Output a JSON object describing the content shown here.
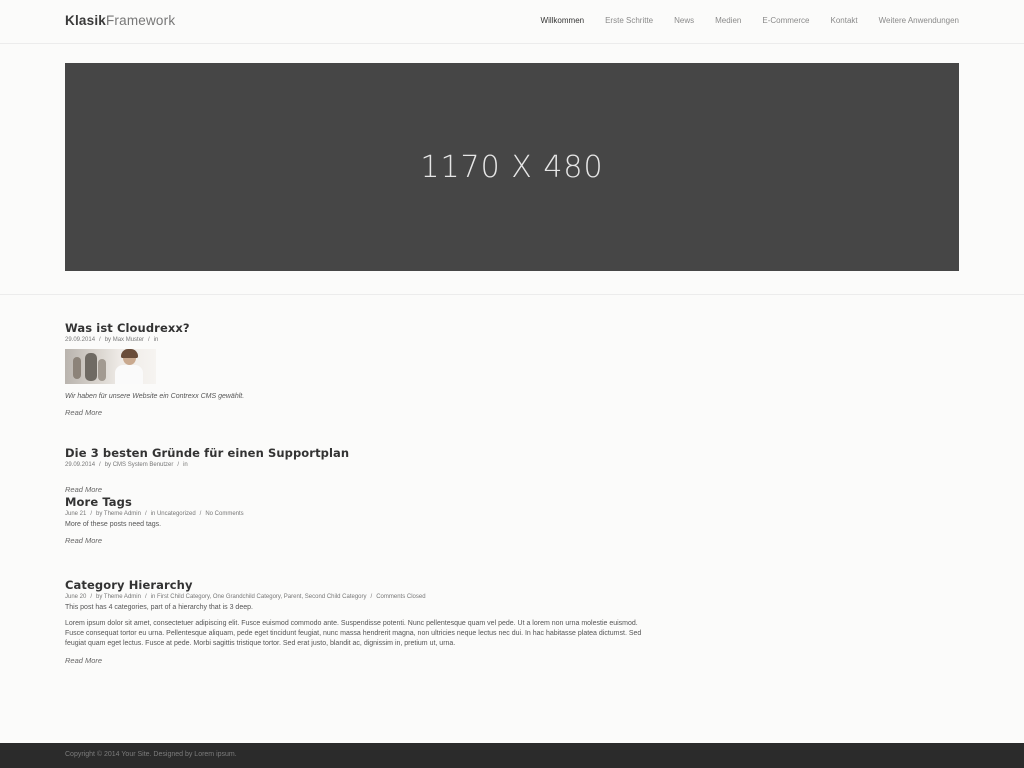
{
  "header": {
    "logo_bold": "Klasik",
    "logo_light": "Framework",
    "nav": [
      "Willkommen",
      "Erste Schritte",
      "News",
      "Medien",
      "E-Commerce",
      "Kontakt",
      "Weitere Anwendungen"
    ]
  },
  "hero": {
    "placeholder_text": "1170 X 480"
  },
  "posts": [
    {
      "title": "Was ist Cloudrexx?",
      "date": "29.09.2014",
      "author": "by Max Muster",
      "in": "in",
      "excerpt": "Wir haben für unsere Website ein Contrexx CMS gewählt.",
      "read_more": "Read More"
    },
    {
      "title": "Die 3 besten Gründe für einen Supportplan",
      "date": "29.09.2014",
      "author": "by CMS System Benutzer",
      "in": "in",
      "read_more": "Read More"
    },
    {
      "title": "More Tags",
      "date": "June 21",
      "author": "by Theme Admin",
      "in": "in Uncategorized",
      "comments": "No Comments",
      "excerpt": "More of these posts need tags.",
      "read_more": "Read More"
    },
    {
      "title": "Category Hierarchy",
      "date": "June 20",
      "author": "by Theme Admin",
      "in": "in First Child Category, One Grandchild Category, Parent, Second Child Category",
      "comments": "Comments Closed",
      "excerpt": "This post has 4 categories, part of a hierarchy that is 3 deep.",
      "body": "Lorem ipsum dolor sit amet, consectetuer adipiscing elit. Fusce euismod commodo ante. Suspendisse potenti. Nunc pellentesque quam vel pede. Ut a lorem non urna molestie euismod. Fusce consequat tortor eu urna. Pellentesque aliquam, pede eget tincidunt feugiat, nunc massa hendrerit magna, non ultricies neque lectus nec dui. In hac habitasse platea dictumst. Sed feugiat quam eget lectus. Fusce at pede. Morbi sagittis tristique tortor. Sed erat justo, blandit ac, dignissim in, pretium ut, urna.",
      "read_more": "Read More"
    }
  ],
  "footer": {
    "copyright": "Copyright © 2014 Your Site. Designed by Lorem ipsum."
  },
  "colors": {
    "hero_bg": "#464646",
    "footer_bg": "#2b2b2b",
    "page_bg": "#fbfbfa"
  }
}
